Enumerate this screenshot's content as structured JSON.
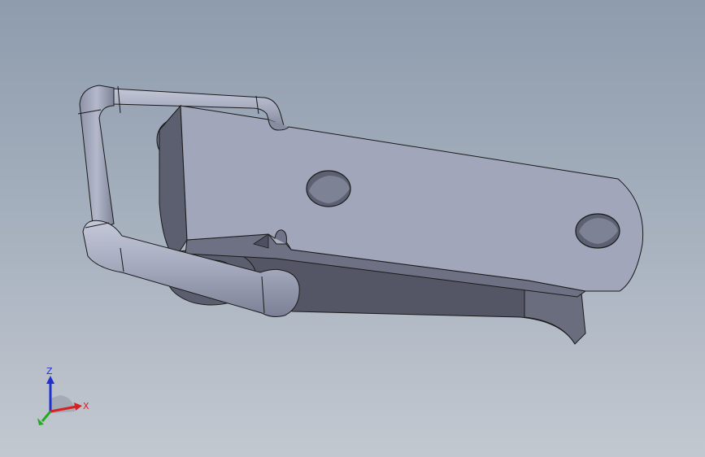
{
  "viewport": {
    "background_top": "#8e9cad",
    "background_bottom": "#c3c8d0"
  },
  "model": {
    "part_color": "#a0a5b9",
    "edge_color": "#1a1a1a"
  },
  "triad": {
    "x_label": "X",
    "y_label": "",
    "z_label": "Z",
    "x_color": "#d92020",
    "y_color": "#22aa22",
    "z_color": "#2030d0"
  }
}
